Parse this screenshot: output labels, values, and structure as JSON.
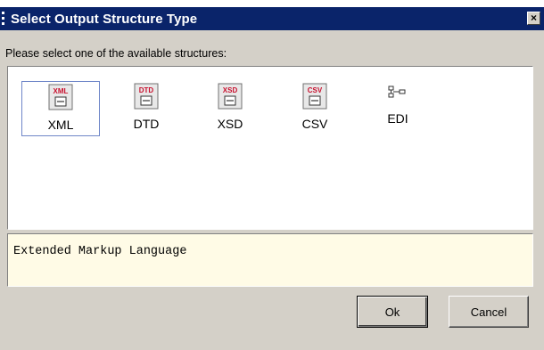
{
  "window": {
    "title": "Select Output Structure Type",
    "close_glyph": "×"
  },
  "instruction": "Please select one of the available structures:",
  "structures": [
    {
      "label": "XML",
      "badge": "XML",
      "icon": "xml-structure-icon",
      "selected": true
    },
    {
      "label": "DTD",
      "badge": "DTD",
      "icon": "dtd-structure-icon",
      "selected": false
    },
    {
      "label": "XSD",
      "badge": "XSD",
      "icon": "xsd-structure-icon",
      "selected": false
    },
    {
      "label": "CSV",
      "badge": "CSV",
      "icon": "csv-structure-icon",
      "selected": false
    },
    {
      "label": "EDI",
      "badge": "",
      "icon": "edi-structure-icon",
      "selected": false
    }
  ],
  "description": "Extended Markup Language",
  "buttons": {
    "ok": "Ok",
    "cancel": "Cancel"
  },
  "colors": {
    "titlebar": "#0a246a",
    "dialog_bg": "#d4d0c8",
    "description_bg": "#fffbe6",
    "badge_red": "#c8102e",
    "selection_border": "#6f86c8"
  }
}
